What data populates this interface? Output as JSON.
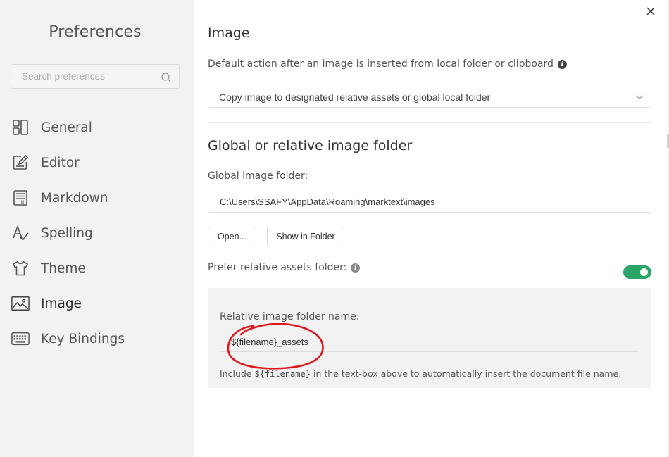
{
  "sidebar": {
    "title": "Preferences",
    "search_placeholder": "Search preferences",
    "items": [
      {
        "label": "General",
        "icon": "general-icon"
      },
      {
        "label": "Editor",
        "icon": "editor-icon"
      },
      {
        "label": "Markdown",
        "icon": "markdown-icon"
      },
      {
        "label": "Spelling",
        "icon": "spelling-icon"
      },
      {
        "label": "Theme",
        "icon": "theme-icon"
      },
      {
        "label": "Image",
        "icon": "image-icon",
        "active": true
      },
      {
        "label": "Key Bindings",
        "icon": "keyboard-icon"
      }
    ]
  },
  "main": {
    "section_title": "Image",
    "default_action_label": "Default action after an image is inserted from local folder or clipboard",
    "default_action_value": "Copy image to designated relative assets or global local folder",
    "folder_section_title": "Global or relative image folder",
    "global_folder_label": "Global image folder:",
    "global_folder_value": "C:\\Users\\SSAFY\\AppData\\Roaming\\marktext\\images",
    "open_button": "Open...",
    "show_in_folder_button": "Show in Folder",
    "prefer_relative_label": "Prefer relative assets folder:",
    "prefer_relative_enabled": true,
    "relative_folder_label": "Relative image folder name:",
    "relative_folder_value": "${filename}_assets",
    "hint_prefix": "Include",
    "hint_code": "${filename}",
    "hint_suffix": "in the text-box above to automatically insert the document file name."
  },
  "colors": {
    "toggle_on": "#2aa56a",
    "annotation": "#e0191e",
    "sidebar_bg": "#f2f2f2"
  }
}
